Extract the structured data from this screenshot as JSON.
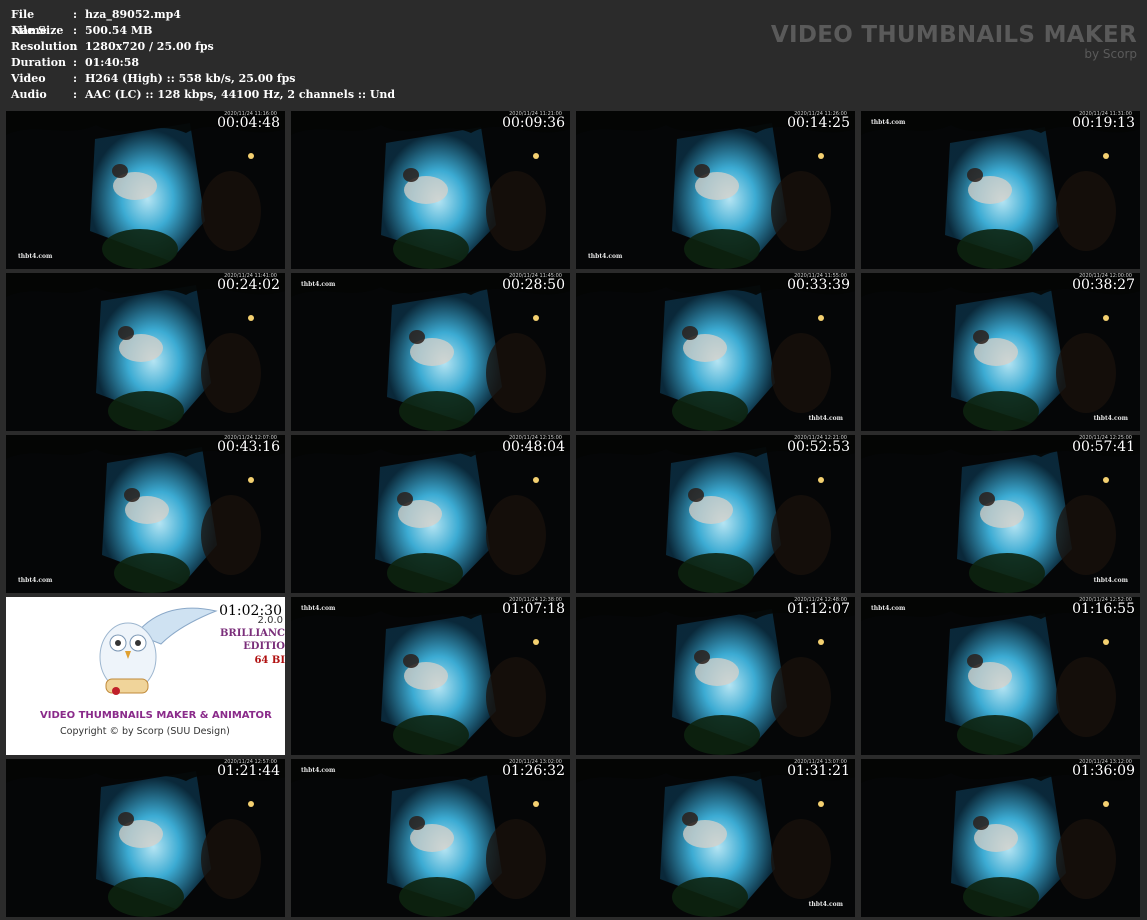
{
  "file_info": [
    {
      "key": "File Name",
      "value": "hza_89052.mp4"
    },
    {
      "key": "File Size",
      "value": "500.54 MB"
    },
    {
      "key": "Resolution",
      "value": "1280x720 / 25.00 fps"
    },
    {
      "key": "Duration",
      "value": "01:40:58"
    },
    {
      "key": "Video",
      "value": "H264 (High) :: 558 kb/s, 25.00 fps"
    },
    {
      "key": "Audio",
      "value": "AAC (LC) :: 128 kbps, 44100 Hz, 2 channels :: Und"
    }
  ],
  "separator": ":",
  "brand": {
    "title": "VIDEO THUMBNAILS MAKER",
    "subtitle": "by Scorp"
  },
  "thumbnails": [
    {
      "time": "00:04:48",
      "stamp": "2020/11/24 11:16:00",
      "watermark": "thbt4.com"
    },
    {
      "time": "00:09:36",
      "stamp": "2020/11/24 11:21:00",
      "watermark": ""
    },
    {
      "time": "00:14:25",
      "stamp": "2020/11/24 11:26:00",
      "watermark": "thbt4.com"
    },
    {
      "time": "00:19:13",
      "stamp": "2020/11/24 11:31:00",
      "watermark": "thbt4.com"
    },
    {
      "time": "00:24:02",
      "stamp": "2020/11/24 11:41:00",
      "watermark": ""
    },
    {
      "time": "00:28:50",
      "stamp": "2020/11/24 11:45:00",
      "watermark": "thbt4.com"
    },
    {
      "time": "00:33:39",
      "stamp": "2020/11/24 11:55:00",
      "watermark": "thbt4.com"
    },
    {
      "time": "00:38:27",
      "stamp": "2020/11/24 12:00:00",
      "watermark": "thbt4.com"
    },
    {
      "time": "00:43:16",
      "stamp": "2020/11/24 12:07:00",
      "watermark": "thbt4.com"
    },
    {
      "time": "00:48:04",
      "stamp": "2020/11/24 12:15:00",
      "watermark": ""
    },
    {
      "time": "00:52:53",
      "stamp": "2020/11/24 12:21:00",
      "watermark": ""
    },
    {
      "time": "00:57:41",
      "stamp": "2020/11/24 12:25:00",
      "watermark": "thbt4.com"
    },
    {
      "promo": true,
      "time": "01:02:30",
      "version": "2.0.0",
      "line1": "BRILLIANC",
      "line2": "EDITIO",
      "line3": "64 BI",
      "product": "VIDEO THUMBNAILS MAKER & ANIMATOR",
      "copyright": "Copyright © by Scorp (SUU Design)"
    },
    {
      "time": "01:07:18",
      "stamp": "2020/11/24 12:38:00",
      "watermark": "thbt4.com"
    },
    {
      "time": "01:12:07",
      "stamp": "2020/11/24 12:48:00",
      "watermark": ""
    },
    {
      "time": "01:16:55",
      "stamp": "2020/11/24 12:52:00",
      "watermark": "thbt4.com"
    },
    {
      "time": "01:21:44",
      "stamp": "2020/11/24 12:57:00",
      "watermark": ""
    },
    {
      "time": "01:26:32",
      "stamp": "2020/11/24 13:02:00",
      "watermark": "thbt4.com"
    },
    {
      "time": "01:31:21",
      "stamp": "2020/11/24 13:07:00",
      "watermark": "thbt4.com"
    },
    {
      "time": "01:36:09",
      "stamp": "2020/11/24 13:12:00",
      "watermark": ""
    }
  ]
}
